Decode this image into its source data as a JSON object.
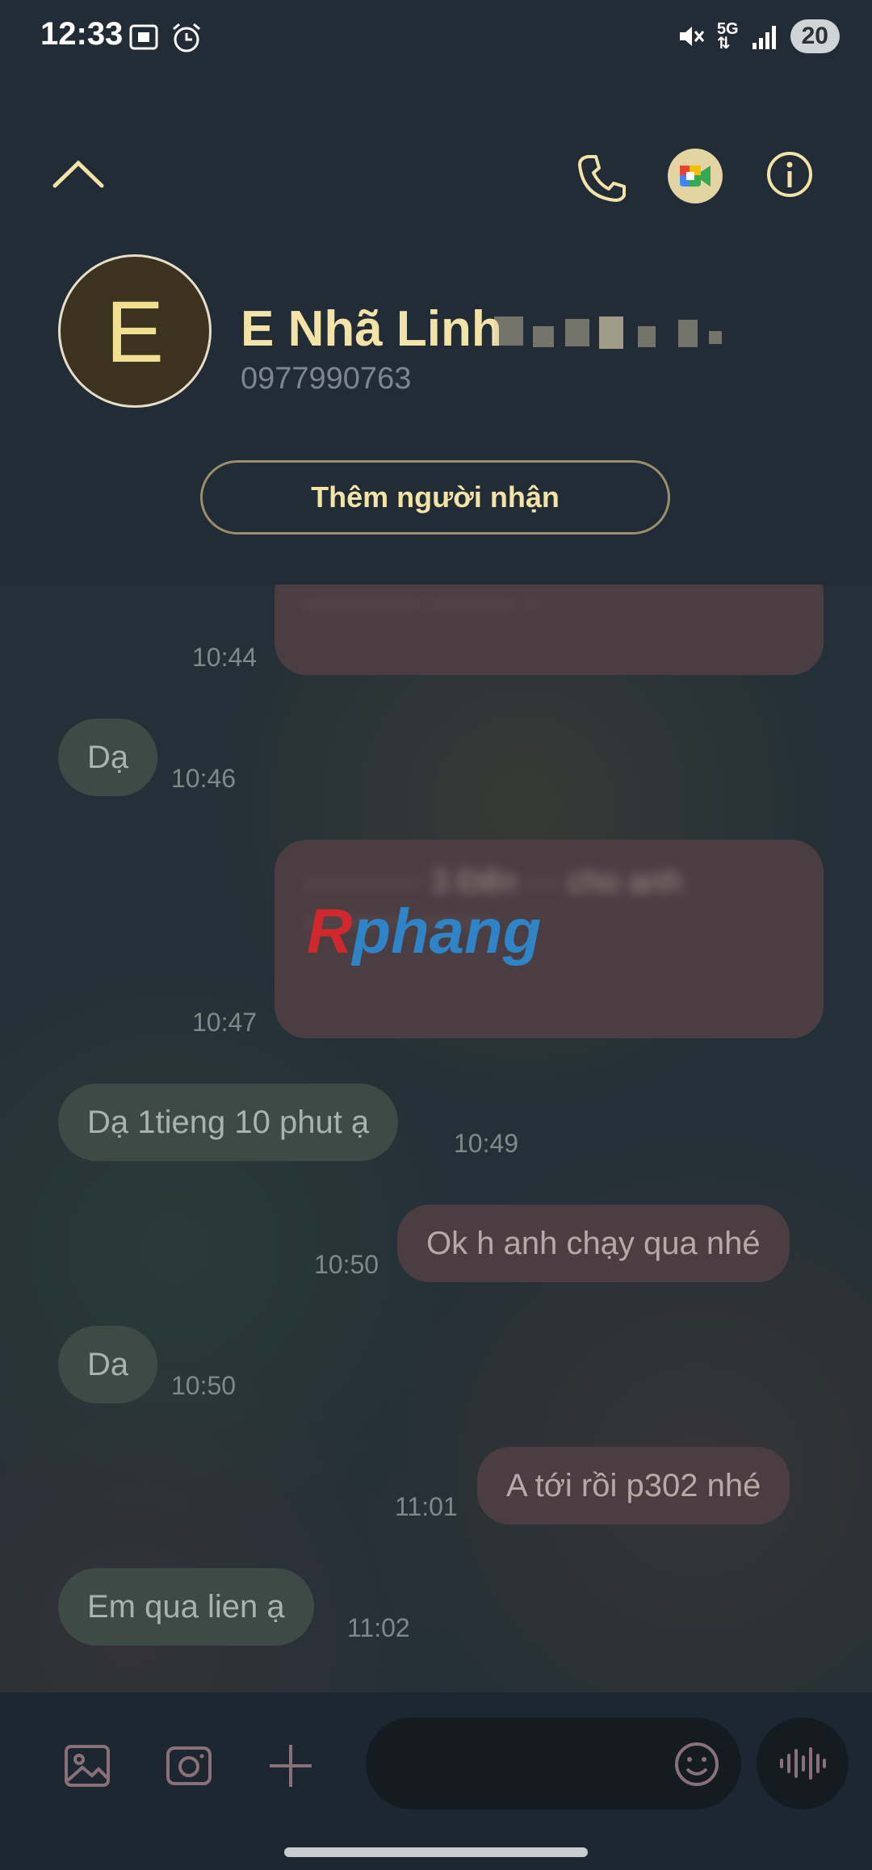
{
  "status_bar": {
    "time": "12:33",
    "network": "5G",
    "battery": "20"
  },
  "contact": {
    "avatar_letter": "E",
    "name": "E Nhã Linh",
    "phone": "0977990763",
    "add_recipient_label": "Thêm người nhận"
  },
  "messages": [
    {
      "direction": "out",
      "text": "··········· ········ ·",
      "time": "10:44",
      "redacted": true
    },
    {
      "direction": "in",
      "text": "Dạ",
      "time": "10:46"
    },
    {
      "direction": "out",
      "text": "··········· 3 Đến ··· cho anh ·········· ·······",
      "time": "10:47",
      "redacted": true
    },
    {
      "direction": "in",
      "text": "Dạ 1tieng 10 phut ạ",
      "time": "10:49"
    },
    {
      "direction": "out",
      "text": "Ok h anh chạy qua nhé",
      "time": "10:50"
    },
    {
      "direction": "in",
      "text": "Da",
      "time": "10:50"
    },
    {
      "direction": "out",
      "text": "A tới rồi p302 nhé",
      "time": "11:01"
    },
    {
      "direction": "in",
      "text": "Em qua lien ạ",
      "time": "11:02"
    }
  ],
  "watermark": {
    "r": "R",
    "rest": "phang"
  },
  "composer": {
    "placeholder": ""
  },
  "colors": {
    "accent": "#f4e3a6",
    "incoming_bubble": "#3e4a45",
    "outgoing_bubble": "#4b3e42"
  }
}
